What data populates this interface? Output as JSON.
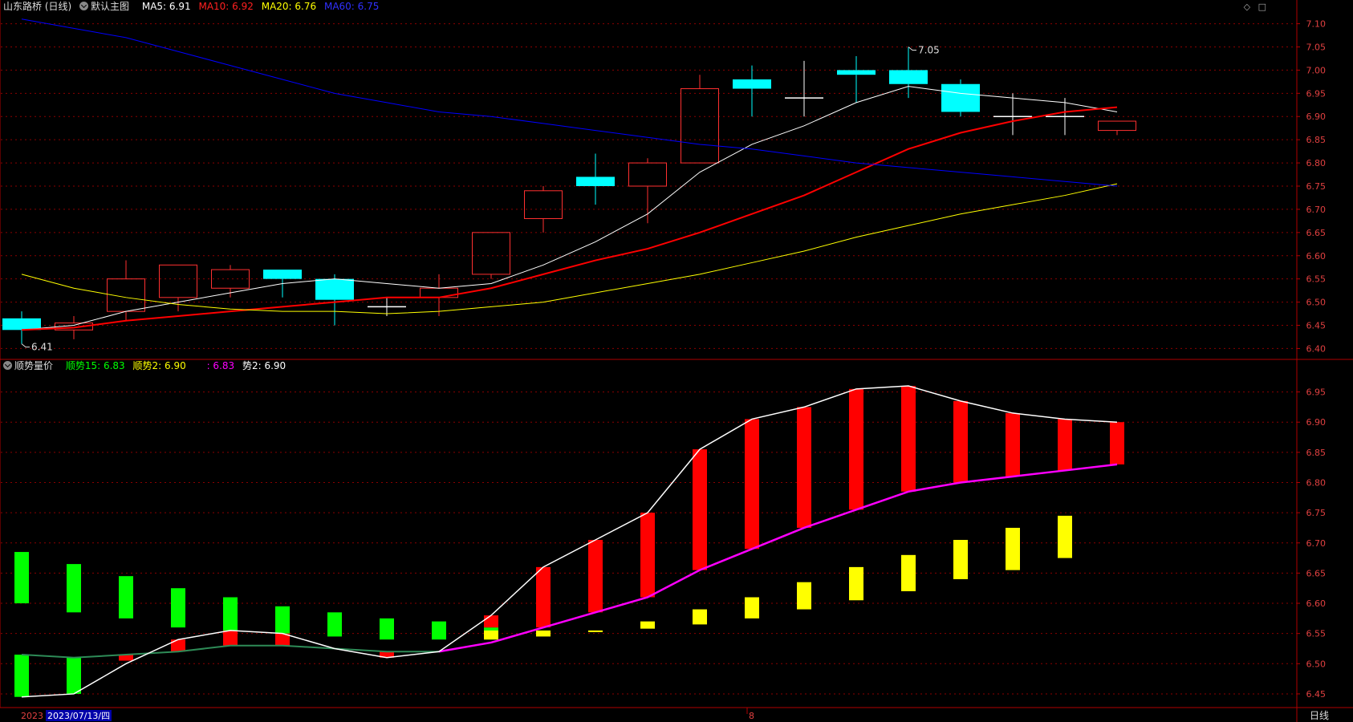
{
  "main_header": {
    "stock_name": "山东路桥 (日线)",
    "template_label": "默认主图",
    "ma5": "MA5: 6.91",
    "ma10": "MA10: 6.92",
    "ma20": "MA20: 6.76",
    "ma60": "MA60: 6.75"
  },
  "sub_header": {
    "indicator_name": "顺势量价",
    "trend15": "顺势15: 6.83",
    "trend2": "顺势2: 6.90",
    "extra1": ": 6.83",
    "extra2": "势2: 6.90"
  },
  "corner_icons": [
    "diamond-icon",
    "square-icon"
  ],
  "bottom_bar": {
    "date_start": "2023",
    "cursor_date": "2023/07/13/四",
    "month_mark": "8",
    "period_label": "日线"
  },
  "colors": {
    "up": "#ff3030",
    "down": "#00ffff",
    "ma5": "#ffffff",
    "ma10": "#ff0000",
    "ma20": "#ffff00",
    "ma60": "#0000ff",
    "trend_line": "#ff00ff",
    "grid": "#8b0000"
  },
  "chart_data": [
    {
      "type": "candlestick",
      "title": "山东路桥 (日线)",
      "ylim": [
        6.38,
        7.12
      ],
      "y_ticks": [
        "7.10",
        "7.05",
        "7.00",
        "6.95",
        "6.90",
        "6.85",
        "6.80",
        "6.75",
        "6.70",
        "6.65",
        "6.60",
        "6.55",
        "6.50",
        "6.45",
        "6.40"
      ],
      "annotations": [
        {
          "label": "7.05",
          "candle": 17,
          "price": 7.05
        },
        {
          "label": "6.41",
          "candle": 0,
          "price": 6.41
        }
      ],
      "candles": [
        {
          "o": 6.465,
          "h": 6.48,
          "l": 6.41,
          "c": 6.44
        },
        {
          "o": 6.44,
          "h": 6.47,
          "l": 6.42,
          "c": 6.455
        },
        {
          "o": 6.48,
          "h": 6.59,
          "l": 6.46,
          "c": 6.55
        },
        {
          "o": 6.51,
          "h": 6.58,
          "l": 6.48,
          "c": 6.58
        },
        {
          "o": 6.53,
          "h": 6.58,
          "l": 6.51,
          "c": 6.57
        },
        {
          "o": 6.57,
          "h": 6.57,
          "l": 6.51,
          "c": 6.55
        },
        {
          "o": 6.55,
          "h": 6.56,
          "l": 6.45,
          "c": 6.505
        },
        {
          "o": 6.49,
          "h": 6.51,
          "l": 6.47,
          "c": 6.49
        },
        {
          "o": 6.51,
          "h": 6.56,
          "l": 6.47,
          "c": 6.53
        },
        {
          "o": 6.56,
          "h": 6.65,
          "l": 6.55,
          "c": 6.65
        },
        {
          "o": 6.68,
          "h": 6.75,
          "l": 6.65,
          "c": 6.74
        },
        {
          "o": 6.77,
          "h": 6.82,
          "l": 6.71,
          "c": 6.75
        },
        {
          "o": 6.75,
          "h": 6.81,
          "l": 6.67,
          "c": 6.8
        },
        {
          "o": 6.8,
          "h": 6.99,
          "l": 6.8,
          "c": 6.96
        },
        {
          "o": 6.98,
          "h": 7.01,
          "l": 6.9,
          "c": 6.96
        },
        {
          "o": 6.94,
          "h": 7.02,
          "l": 6.9,
          "c": 6.94
        },
        {
          "o": 7.0,
          "h": 7.03,
          "l": 6.93,
          "c": 6.99
        },
        {
          "o": 7.0,
          "h": 7.05,
          "l": 6.94,
          "c": 6.97
        },
        {
          "o": 6.97,
          "h": 6.98,
          "l": 6.9,
          "c": 6.91
        },
        {
          "o": 6.9,
          "h": 6.95,
          "l": 6.86,
          "c": 6.9
        },
        {
          "o": 6.9,
          "h": 6.94,
          "l": 6.86,
          "c": 6.9
        },
        {
          "o": 6.87,
          "h": 6.89,
          "l": 6.86,
          "c": 6.89
        }
      ],
      "series": [
        {
          "name": "MA5",
          "values": [
            6.44,
            6.45,
            6.48,
            6.5,
            6.52,
            6.54,
            6.55,
            6.54,
            6.53,
            6.54,
            6.58,
            6.63,
            6.69,
            6.78,
            6.84,
            6.88,
            6.93,
            6.965,
            6.95,
            6.94,
            6.93,
            6.91
          ]
        },
        {
          "name": "MA10",
          "values": [
            6.44,
            6.445,
            6.46,
            6.47,
            6.48,
            6.49,
            6.5,
            6.51,
            6.51,
            6.53,
            6.56,
            6.59,
            6.615,
            6.65,
            6.69,
            6.73,
            6.78,
            6.83,
            6.865,
            6.89,
            6.91,
            6.92
          ]
        },
        {
          "name": "MA20",
          "values": [
            6.56,
            6.53,
            6.51,
            6.495,
            6.485,
            6.48,
            6.48,
            6.475,
            6.48,
            6.49,
            6.5,
            6.52,
            6.54,
            6.56,
            6.585,
            6.61,
            6.64,
            6.665,
            6.69,
            6.71,
            6.73,
            6.755
          ]
        },
        {
          "name": "MA60",
          "values": [
            7.11,
            7.09,
            7.07,
            7.04,
            7.01,
            6.98,
            6.95,
            6.93,
            6.91,
            6.9,
            6.885,
            6.87,
            6.855,
            6.84,
            6.83,
            6.815,
            6.8,
            6.79,
            6.78,
            6.77,
            6.76,
            6.75
          ]
        }
      ]
    },
    {
      "type": "bar",
      "title": "顺势量价",
      "ylim": [
        6.43,
        6.98
      ],
      "y_ticks": [
        "6.95",
        "6.90",
        "6.85",
        "6.80",
        "6.75",
        "6.70",
        "6.65",
        "6.60",
        "6.55",
        "6.50",
        "6.45"
      ],
      "green_bars": [
        [
          6.6,
          6.685
        ],
        [
          6.585,
          6.665
        ],
        [
          6.575,
          6.645
        ],
        [
          6.56,
          6.625
        ],
        [
          6.55,
          6.61
        ],
        [
          6.545,
          6.595
        ],
        [
          6.545,
          6.585
        ],
        [
          6.54,
          6.575
        ],
        [
          6.54,
          6.57
        ],
        [
          6.54,
          6.56
        ],
        null,
        null,
        null,
        null,
        null,
        null,
        null,
        null,
        null,
        null,
        null,
        null
      ],
      "green_low_bars": [
        [
          6.445,
          6.515
        ],
        [
          6.45,
          6.51
        ],
        null,
        null,
        null,
        null,
        null,
        null,
        null,
        null,
        null,
        null,
        null,
        null,
        null,
        null,
        null,
        null,
        null,
        null,
        null,
        null
      ],
      "red_bars": [
        null,
        null,
        [
          6.505,
          6.515
        ],
        [
          6.52,
          6.54
        ],
        [
          6.53,
          6.555
        ],
        [
          6.53,
          6.55
        ],
        null,
        [
          6.51,
          6.52
        ],
        null,
        [
          6.56,
          6.58
        ],
        [
          6.56,
          6.66
        ],
        [
          6.585,
          6.705
        ],
        [
          6.61,
          6.75
        ],
        [
          6.655,
          6.855
        ],
        [
          6.69,
          6.905
        ],
        [
          6.725,
          6.925
        ],
        [
          6.755,
          6.955
        ],
        [
          6.785,
          6.96
        ],
        [
          6.8,
          6.935
        ],
        [
          6.81,
          6.915
        ],
        [
          6.82,
          6.905
        ],
        [
          6.83,
          6.9
        ]
      ],
      "yellow_bars": [
        null,
        null,
        null,
        null,
        null,
        null,
        null,
        null,
        null,
        [
          6.54,
          6.555
        ],
        [
          6.545,
          6.555
        ],
        [
          6.553,
          6.555
        ],
        [
          6.558,
          6.57
        ],
        [
          6.565,
          6.59
        ],
        [
          6.575,
          6.61
        ],
        [
          6.59,
          6.635
        ],
        [
          6.605,
          6.66
        ],
        [
          6.62,
          6.68
        ],
        [
          6.64,
          6.705
        ],
        [
          6.655,
          6.725
        ],
        [
          6.675,
          6.745
        ],
        null
      ],
      "series": [
        {
          "name": "顺势2",
          "values": [
            6.445,
            6.45,
            6.5,
            6.54,
            6.555,
            6.55,
            6.525,
            6.51,
            6.52,
            6.58,
            6.66,
            6.705,
            6.75,
            6.855,
            6.905,
            6.925,
            6.955,
            6.96,
            6.935,
            6.915,
            6.905,
            6.9
          ]
        },
        {
          "name": "顺势15",
          "values": [
            6.515,
            6.51,
            6.515,
            6.52,
            6.53,
            6.53,
            6.525,
            6.52,
            6.52,
            6.535,
            6.56,
            6.585,
            6.61,
            6.655,
            6.69,
            6.725,
            6.755,
            6.785,
            6.8,
            6.81,
            6.82,
            6.83
          ]
        }
      ]
    }
  ]
}
